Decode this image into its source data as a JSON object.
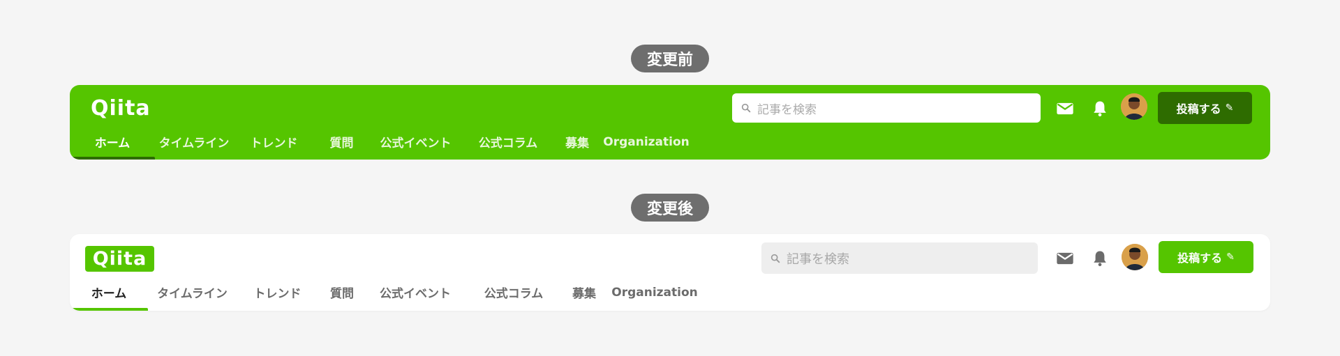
{
  "labels": {
    "before": "変更前",
    "after": "変更後"
  },
  "colors": {
    "brand_green": "#55c500",
    "dark_green": "#2e6c00",
    "page_bg": "#f5f5f5",
    "label_bg": "#6e6e6e"
  },
  "before": {
    "logo": "Qiita",
    "search_placeholder": "記事を検索",
    "post_button": "投稿する",
    "icons": [
      "search-icon",
      "mail-icon",
      "bell-icon",
      "pencil-icon"
    ],
    "tabs": [
      "ホーム",
      "タイムライン",
      "トレンド",
      "質問",
      "公式イベント",
      "公式コラム",
      "募集",
      "Organization"
    ],
    "active_tab": "ホーム"
  },
  "after": {
    "logo": "Qiita",
    "search_placeholder": "記事を検索",
    "post_button": "投稿する",
    "icons": [
      "search-icon",
      "mail-icon",
      "bell-icon",
      "pencil-icon"
    ],
    "tabs": [
      "ホーム",
      "タイムライン",
      "トレンド",
      "質問",
      "公式イベント",
      "公式コラム",
      "募集",
      "Organization"
    ],
    "active_tab": "ホーム"
  }
}
